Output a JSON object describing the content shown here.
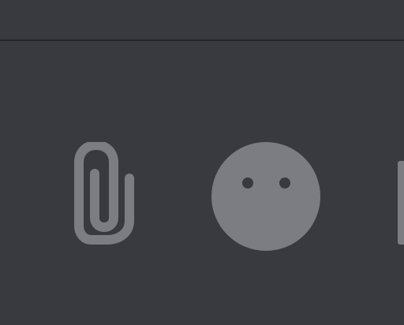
{
  "toolbar": {
    "attach_button": {
      "icon": "paperclip-icon"
    },
    "emoji_button": {
      "icon": "smiley-face-icon"
    },
    "partial_button": {
      "icon": "partial-icon"
    }
  },
  "colors": {
    "background": "#383a40",
    "divider": "#24262a",
    "icon": "#7b7d82",
    "icon_cutout": "#383a40"
  }
}
